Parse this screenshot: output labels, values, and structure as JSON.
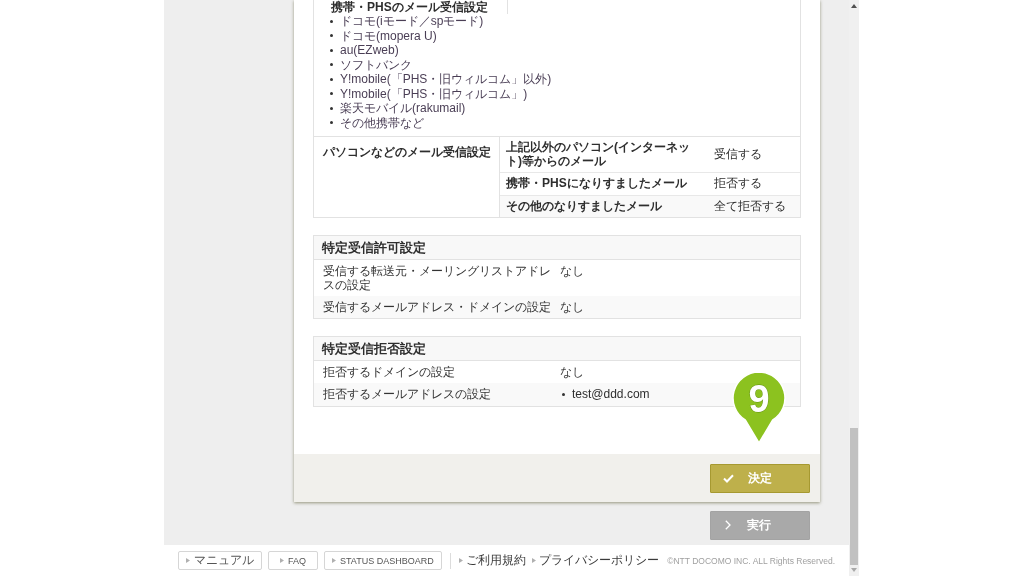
{
  "mail_settings_table": {
    "rows": [
      {
        "kind": "list",
        "label": "携帯・PHSのメール受信設定",
        "items": [
          "ドコモ(iモード／spモード)",
          "ドコモ(mopera U)",
          "au(EZweb)",
          "ソフトバンク",
          "Y!mobile(「PHS・旧ウィルコム」以外)",
          "Y!mobile(「PHS・旧ウィルコム」)",
          "楽天モバイル(rakumail)",
          "その他携帯など"
        ]
      },
      {
        "kind": "pairs",
        "label": "パソコンなどのメール受信設定",
        "rows": [
          {
            "name": "上記以外のパソコン(インターネット)等からのメール",
            "value": "受信する"
          },
          {
            "name": "携帯・PHSになりすましたメール",
            "value": "拒否する"
          },
          {
            "name": "その他のなりすましたメール",
            "value": "全て拒否する"
          }
        ]
      }
    ]
  },
  "sections": [
    {
      "title": "特定受信許可設定",
      "rows": [
        {
          "kind": "text",
          "label": "受信する転送元・メーリングリストアドレスの設定",
          "value": "なし"
        },
        {
          "kind": "text",
          "label": "受信するメールアドレス・ドメインの設定",
          "value": "なし"
        }
      ]
    },
    {
      "title": "特定受信拒否設定",
      "rows": [
        {
          "kind": "text",
          "label": "拒否するドメインの設定",
          "value": "なし"
        },
        {
          "kind": "list",
          "label": "拒否するメールアドレスの設定",
          "items": [
            "test@ddd.com"
          ]
        }
      ]
    }
  ],
  "callout": {
    "label": "9"
  },
  "confirm_button": {
    "label": "決定",
    "disabled": false
  },
  "execute_button": {
    "label": "実行",
    "disabled": true
  },
  "footer": {
    "buttons": [
      "マニュアル",
      "FAQ",
      "STATUS DASHBOARD"
    ],
    "links": [
      "ご利用規約",
      "プライバシーポリシー"
    ],
    "copyright": "©NTT DOCOMO INC. ALL Rights Reserved."
  }
}
